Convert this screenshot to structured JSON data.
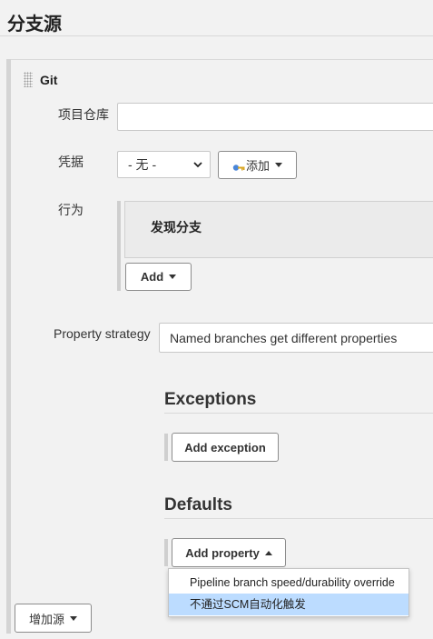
{
  "section": {
    "title": "分支源"
  },
  "git": {
    "title": "Git",
    "repo_label": "项目仓库",
    "repo_value": "",
    "credentials_label": "凭据",
    "credentials_selected": "- 无 -",
    "add_button_label": "添加",
    "behavior_label": "行为",
    "behavior_item": "发现分支",
    "behavior_add_label": "Add"
  },
  "property_strategy": {
    "label": "Property strategy",
    "selected": "Named branches get different properties"
  },
  "exceptions": {
    "heading": "Exceptions",
    "add_label": "Add exception"
  },
  "defaults": {
    "heading": "Defaults",
    "add_label": "Add property"
  },
  "menu": {
    "items": [
      {
        "label": "Pipeline branch speed/durability override",
        "active": false
      },
      {
        "label": "不通过SCM自动化触发",
        "active": true
      }
    ]
  },
  "footer": {
    "add_source_label": "增加源"
  },
  "colors": {
    "menu_highlight": "#bcdcff",
    "key_icon_blue": "#4a86d8",
    "key_icon_gold": "#d9a521"
  }
}
